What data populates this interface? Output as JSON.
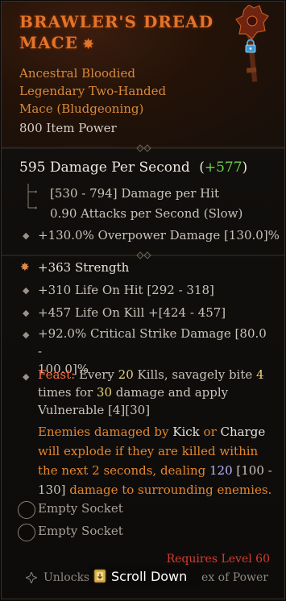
{
  "item": {
    "name": "Brawler's Dread Mace",
    "name_line1": "BRAWLER'S DREAD",
    "name_line2": "MACE",
    "star": "✸",
    "type_lines": [
      "Ancestral Bloodied",
      "Legendary Two-Handed",
      "Mace (Bludgeoning)"
    ],
    "item_power": "800 Item Power",
    "weapon_icon": "mace-icon",
    "lock_icon": "lock-icon"
  },
  "dps": {
    "main": "595 Damage Per Second",
    "delta_open": "(",
    "delta": "+577",
    "delta_close": ")"
  },
  "base_stats": [
    "[530 - 794] Damage per Hit",
    "0.90 Attacks per Second (Slow)",
    "+130.0% Overpower Damage [130.0]%"
  ],
  "affixes": {
    "strength": "+363 Strength",
    "life_on_hit": "+310 Life On Hit [292 - 318]",
    "life_on_kill": "+457 Life On Kill +[424 - 457]",
    "crit_line1": "+92.0% Critical Strike Damage [80.0 -",
    "crit_line2": "100.0]%"
  },
  "feast": {
    "name": "Feast:",
    "l1_a": " Every ",
    "l1_num": "20",
    "l1_b": " Kills, savagely bite ",
    "l1_num2": "4",
    "l2_a": "times for ",
    "l2_num": "30",
    "l2_b": " damage and apply",
    "l3": "Vulnerable [4][30]"
  },
  "aspect": {
    "l1_a": "Enemies damaged by ",
    "l1_kick": "Kick",
    "l1_or": " or ",
    "l1_charge": "Charge",
    "l2": "will explode if they are killed within",
    "l3_a": "the next 2 seconds, dealing ",
    "l3_num": "120",
    "l3_b": " [100 -",
    "l4_a": "130]",
    "l4_b": " damage to surrounding enemies."
  },
  "sockets": [
    "Empty Socket",
    "Empty Socket"
  ],
  "requirement": "Requires Level 60",
  "footer": {
    "unlocks": "Unlocks",
    "scroll": "Scroll Down",
    "codex": "dex of Power"
  },
  "colors": {
    "legendary": "#e3742a",
    "delta_green": "#6ad24a",
    "requirement_red": "#d63b2e"
  }
}
